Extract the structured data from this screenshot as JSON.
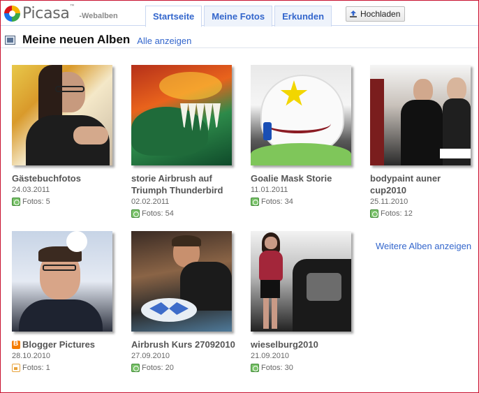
{
  "app": {
    "logo_text": "Picasa",
    "logo_tm": "™",
    "logo_sub": "-Webalben"
  },
  "tabs": [
    {
      "label": "Startseite",
      "active": true
    },
    {
      "label": "Meine Fotos",
      "active": false
    },
    {
      "label": "Erkunden",
      "active": false
    }
  ],
  "upload": {
    "label": "Hochladen",
    "icon": "upload-icon"
  },
  "section": {
    "title": "Meine neuen Alben",
    "all_link": "Alle anzeigen",
    "icon": "album-icon"
  },
  "albums": [
    {
      "title": "Gästebuchfotos",
      "date": "24.03.2011",
      "count": "Fotos: 5",
      "access": "public"
    },
    {
      "title": "storie Airbrush auf Triumph Thunderbird",
      "date": "02.02.2011",
      "count": "Fotos: 54",
      "access": "public"
    },
    {
      "title": "Goalie Mask Storie",
      "date": "11.01.2011",
      "count": "Fotos: 34",
      "access": "public"
    },
    {
      "title": "bodypaint auner cup2010",
      "date": "25.11.2010",
      "count": "Fotos: 12",
      "access": "public"
    },
    {
      "title": "Blogger Pictures",
      "date": "28.10.2010",
      "count": "Fotos: 1",
      "access": "locked",
      "source": "blogger"
    },
    {
      "title": "Airbrush Kurs 27092010",
      "date": "27.09.2010",
      "count": "Fotos: 20",
      "access": "public"
    },
    {
      "title": "wieselburg2010",
      "date": "21.09.2010",
      "count": "Fotos: 30",
      "access": "public"
    }
  ],
  "more_albums": "Weitere Alben anzeigen",
  "colors": {
    "frame": "#c8102e",
    "link": "#3366cc",
    "tab_bg": "#eef3fb",
    "public_badge": "#7bc36b",
    "locked_badge": "#e8a23a",
    "blogger_badge": "#f57d00"
  }
}
